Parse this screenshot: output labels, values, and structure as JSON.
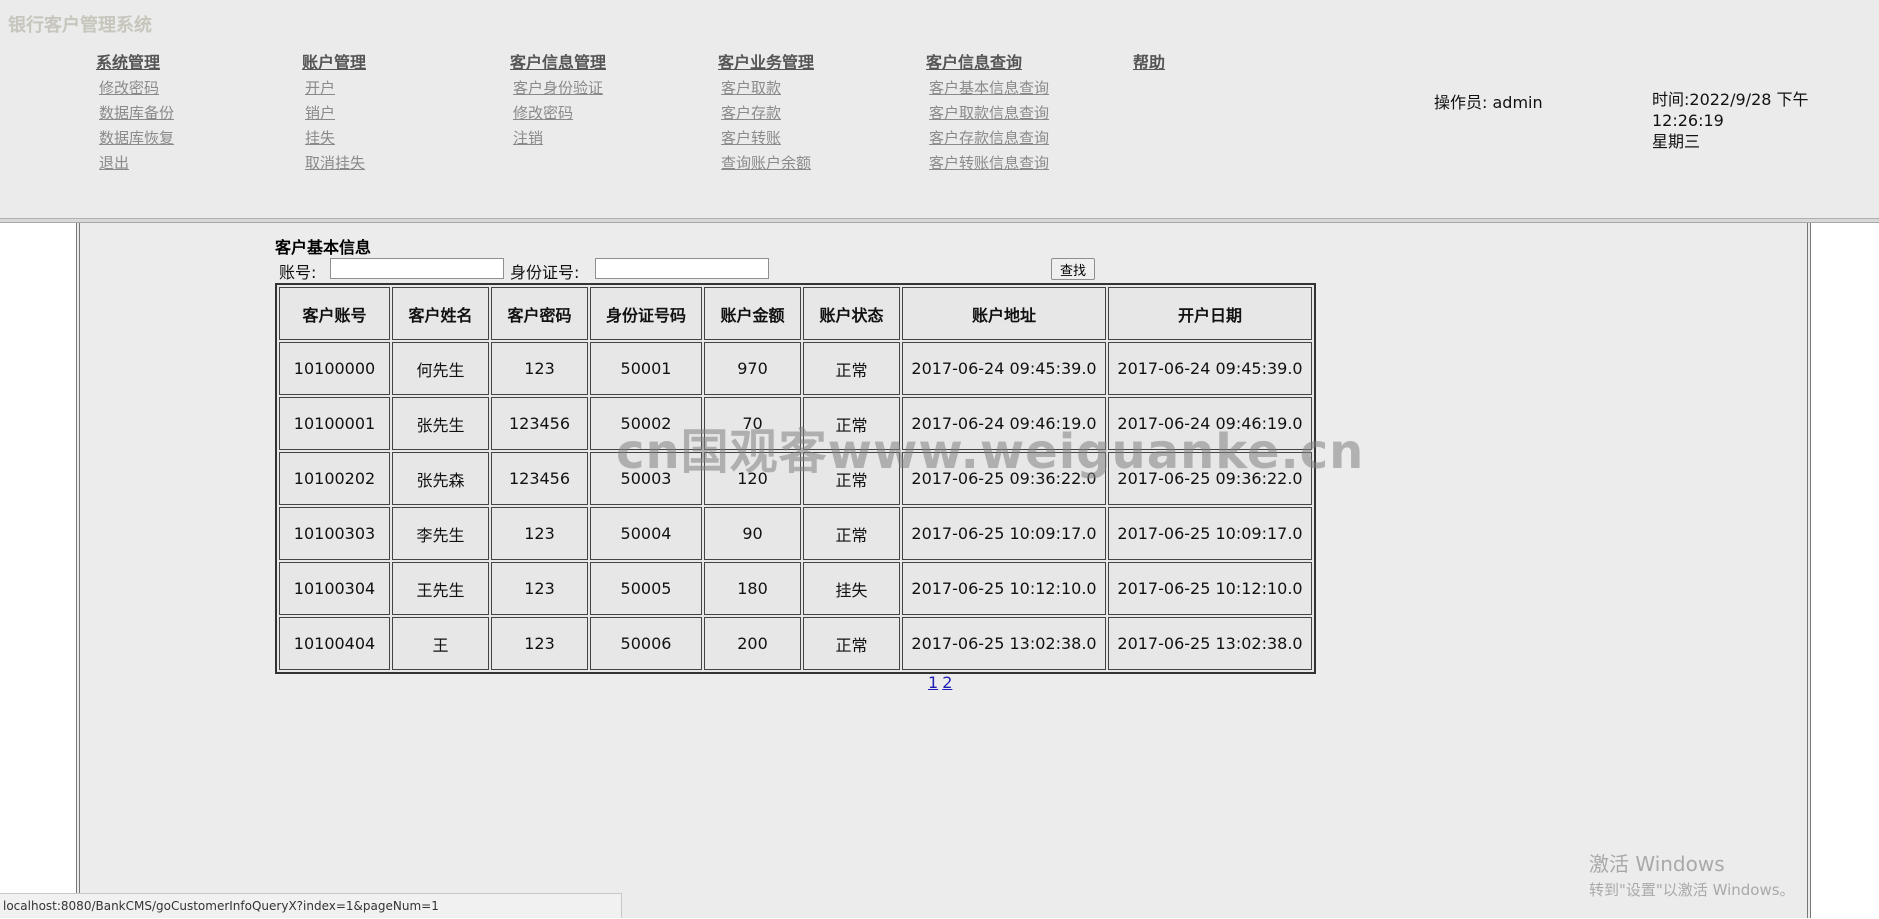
{
  "app_title": "银行客户管理系统",
  "menus": [
    {
      "title": "系统管理",
      "items": [
        "修改密码",
        "数据库备份",
        "数据库恢复",
        "退出"
      ]
    },
    {
      "title": "账户管理",
      "items": [
        "开户",
        "销户",
        "挂失",
        "取消挂失"
      ]
    },
    {
      "title": "客户信息管理",
      "items": [
        "客户身份验证",
        "修改密码",
        "注销"
      ]
    },
    {
      "title": "客户业务管理",
      "items": [
        "客户取款",
        "客户存款",
        "客户转账",
        "查询账户余额"
      ]
    },
    {
      "title": "客户信息查询",
      "items": [
        "客户基本信息查询",
        "客户取款信息查询",
        "客户存款信息查询",
        "客户转账信息查询"
      ]
    },
    {
      "title": "帮助",
      "items": []
    }
  ],
  "operator": "操作员: admin",
  "time_line1": "时间:2022/9/28 下午12:26:19",
  "time_line2": "星期三",
  "section_title": "客户基本信息",
  "search": {
    "account_label": "账号:",
    "account_value": "",
    "id_label": "身份证号:",
    "id_value": "",
    "button": "查找"
  },
  "table": {
    "headers": [
      "客户账号",
      "客户姓名",
      "客户密码",
      "身份证号码",
      "账户金额",
      "账户状态",
      "账户地址",
      "开户日期"
    ],
    "rows": [
      [
        "10100000",
        "何先生",
        "123",
        "50001",
        "970",
        "正常",
        "2017-06-24 09:45:39.0",
        "2017-06-24 09:45:39.0"
      ],
      [
        "10100001",
        "张先生",
        "123456",
        "50002",
        "70",
        "正常",
        "2017-06-24 09:46:19.0",
        "2017-06-24 09:46:19.0"
      ],
      [
        "10100202",
        "张先森",
        "123456",
        "50003",
        "120",
        "正常",
        "2017-06-25 09:36:22.0",
        "2017-06-25 09:36:22.0"
      ],
      [
        "10100303",
        "李先生",
        "123",
        "50004",
        "90",
        "正常",
        "2017-06-25 10:09:17.0",
        "2017-06-25 10:09:17.0"
      ],
      [
        "10100304",
        "王先生",
        "123",
        "50005",
        "180",
        "挂失",
        "2017-06-25 10:12:10.0",
        "2017-06-25 10:12:10.0"
      ],
      [
        "10100404",
        "王",
        "123",
        "50006",
        "200",
        "正常",
        "2017-06-25 13:02:38.0",
        "2017-06-25 13:02:38.0"
      ]
    ]
  },
  "pager": [
    "1",
    "2"
  ],
  "watermark": "cn国观客www.weiguanke.cn",
  "windows_activation": {
    "line1": "激活 Windows",
    "line2": "转到\"设置\"以激活 Windows。"
  },
  "status_url": "localhost:8080/BankCMS/goCustomerInfoQueryX?index=1&pageNum=1",
  "colors": {
    "header_bg": "#ebebeb",
    "content_bg": "#ececec",
    "link_gray": "#8a8a8a",
    "pager_link": "#1f1fb5"
  }
}
